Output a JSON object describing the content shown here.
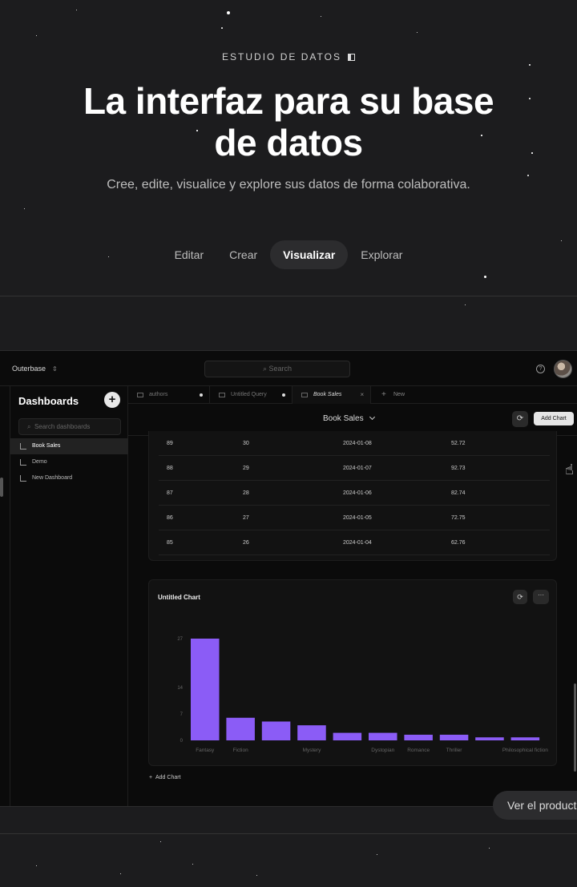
{
  "hero": {
    "eyebrow": "ESTUDIO DE DATOS",
    "headline_line1": "La interfaz para su base",
    "headline_line2": "de datos",
    "subline": "Cree, edite, visualice y explore sus datos de forma colaborativa.",
    "modes": [
      {
        "label": "Editar",
        "active": false
      },
      {
        "label": "Crear",
        "active": false
      },
      {
        "label": "Visualizar",
        "active": true
      },
      {
        "label": "Explorar",
        "active": false
      }
    ]
  },
  "app": {
    "brand": "Outerbase",
    "search_placeholder": "Search",
    "sidebar": {
      "title": "Dashboards",
      "search_placeholder": "Search dashboards",
      "items": [
        {
          "label": "Book Sales",
          "active": true
        },
        {
          "label": "Demo",
          "active": false
        },
        {
          "label": "New Dashboard",
          "active": false
        }
      ]
    },
    "tabs": [
      {
        "label": "authors"
      },
      {
        "label": "Untitled Query"
      },
      {
        "label": "Book Sales"
      },
      {
        "label": "New"
      }
    ],
    "dashboard_title": "Book Sales",
    "add_chart_button": "Add Chart",
    "table_rows": [
      [
        "89",
        "30",
        "2024-01-08",
        "52.72"
      ],
      [
        "88",
        "29",
        "2024-01-07",
        "92.73"
      ],
      [
        "87",
        "28",
        "2024-01-06",
        "82.74"
      ],
      [
        "86",
        "27",
        "2024-01-05",
        "72.75"
      ],
      [
        "85",
        "26",
        "2024-01-04",
        "62.76"
      ]
    ],
    "chart_title": "Untitled Chart",
    "add_chart_link": "Add Chart"
  },
  "chart_data": {
    "type": "bar",
    "title": "Untitled Chart",
    "categories": [
      "Fantasy",
      "Fiction",
      "",
      "Mystery",
      "",
      "Dystopian",
      "Romance",
      "Thriller",
      "",
      "Philosophical fiction"
    ],
    "values": [
      27,
      6,
      5,
      4,
      2,
      2,
      1.5,
      1.5,
      0.8,
      0.8
    ],
    "yticks": [
      0,
      7,
      14,
      27
    ],
    "ylim": [
      0,
      27
    ],
    "grid": false,
    "bar_color": "#8b5cf6"
  },
  "cta": {
    "label": "Ver el producto"
  },
  "colors": {
    "background": "#1c1c1e",
    "app_background": "#0b0b0b",
    "accent": "#8b5cf6"
  }
}
